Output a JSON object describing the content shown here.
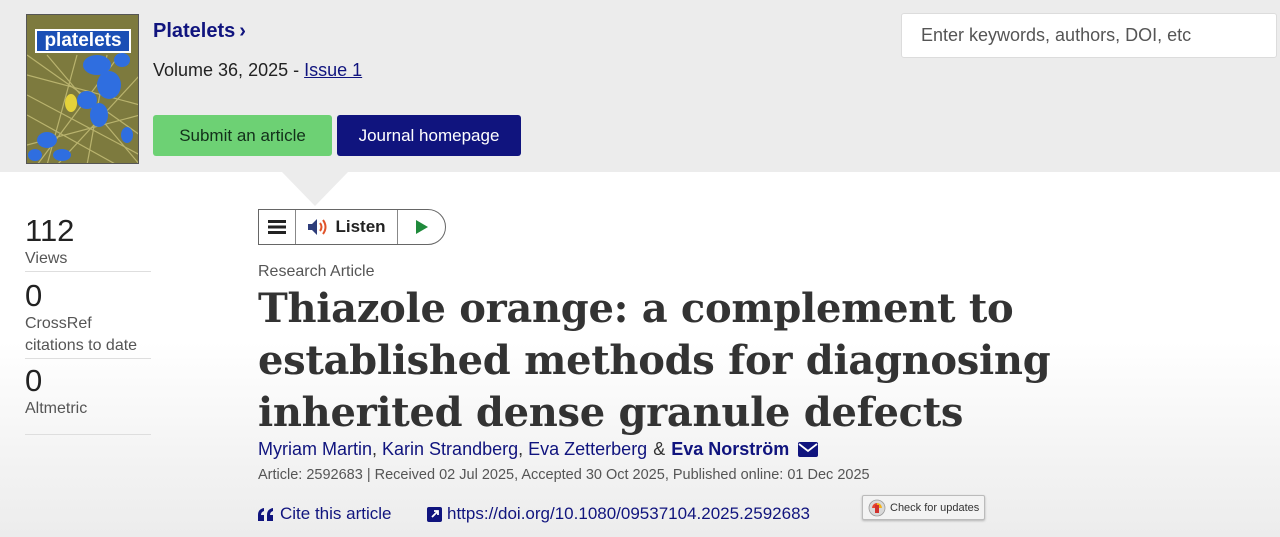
{
  "journal": {
    "name": "Platelets",
    "chevron": "›",
    "volume_text": "Volume 36, 2025 - ",
    "issue_link": "Issue 1",
    "cover_logo_text": "platelets"
  },
  "buttons": {
    "submit": "Submit an article",
    "homepage": "Journal homepage"
  },
  "search": {
    "placeholder": "Enter keywords, authors, DOI, etc"
  },
  "metrics": [
    {
      "value": "112",
      "label": "Views"
    },
    {
      "value": "0",
      "label": "CrossRef citations to date"
    },
    {
      "value": "0",
      "label": "Altmetric"
    }
  ],
  "listen": {
    "label": "Listen"
  },
  "article": {
    "type": "Research Article",
    "title": "Thiazole orange: a complement to established methods for diagnosing inherited dense granule defects",
    "authors": [
      "Myriam Martin",
      "Karin Strandberg",
      "Eva Zetterberg"
    ],
    "corresponding_author": "Eva Norström",
    "ampersand": "&",
    "comma": ",",
    "meta": "Article: 2592683 | Received 02 Jul 2025, Accepted 30 Oct 2025, Published online: 01 Dec 2025",
    "cite_label": "Cite this article",
    "doi": "https://doi.org/10.1080/09537104.2025.2592683",
    "check_updates": "Check for updates"
  },
  "colors": {
    "brand_navy": "#10147e",
    "submit_green": "#6dd174",
    "header_gray": "#ececec"
  },
  "icons": [
    "hamburger-icon",
    "speaker-icon",
    "play-icon",
    "envelope-icon",
    "quote-icon",
    "external-link-icon",
    "crossmark-icon"
  ]
}
